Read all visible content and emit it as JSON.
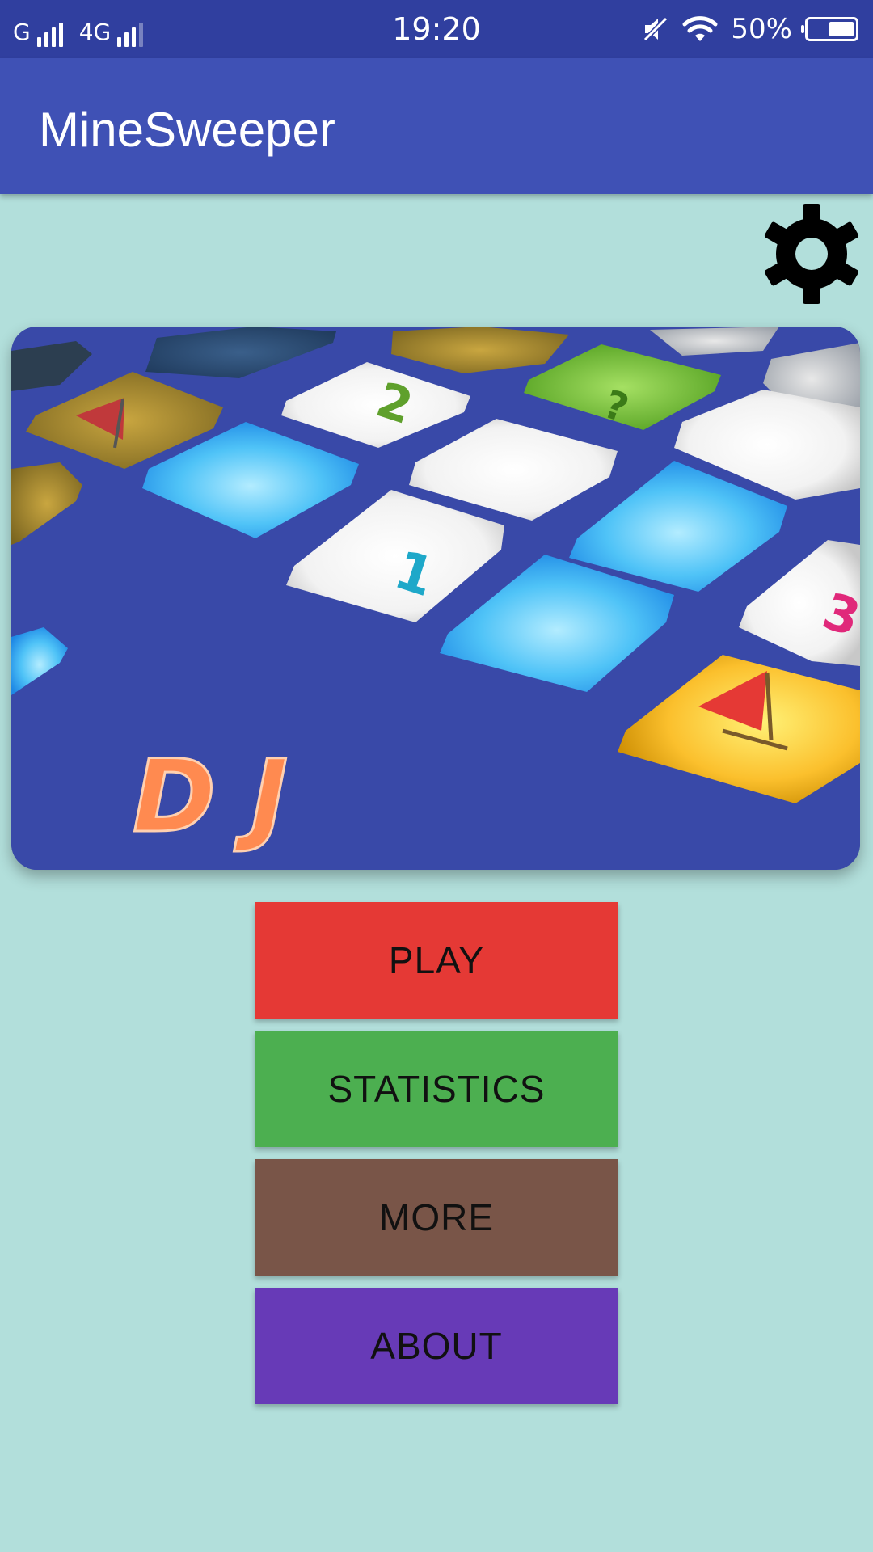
{
  "status_bar": {
    "network1": "G",
    "network2": "4G",
    "time": "19:20",
    "battery": "50%",
    "battery_level": 0.5,
    "icons": [
      "signal-icon",
      "mute-icon",
      "wifi-icon",
      "battery-icon"
    ]
  },
  "app_bar": {
    "title": "MineSweeper",
    "color": "#3f51b5"
  },
  "settings": {
    "icon": "gear-icon"
  },
  "hero": {
    "text": "D J",
    "tiles": [
      "2",
      "1",
      "3",
      "?"
    ]
  },
  "menu": {
    "play": "PLAY",
    "statistics": "STATISTICS",
    "more": "MORE",
    "about": "ABOUT"
  },
  "colors": {
    "background": "#b2dfdb",
    "play": "#e53935",
    "statistics": "#4caf50",
    "more": "#795548",
    "about": "#673ab7"
  }
}
